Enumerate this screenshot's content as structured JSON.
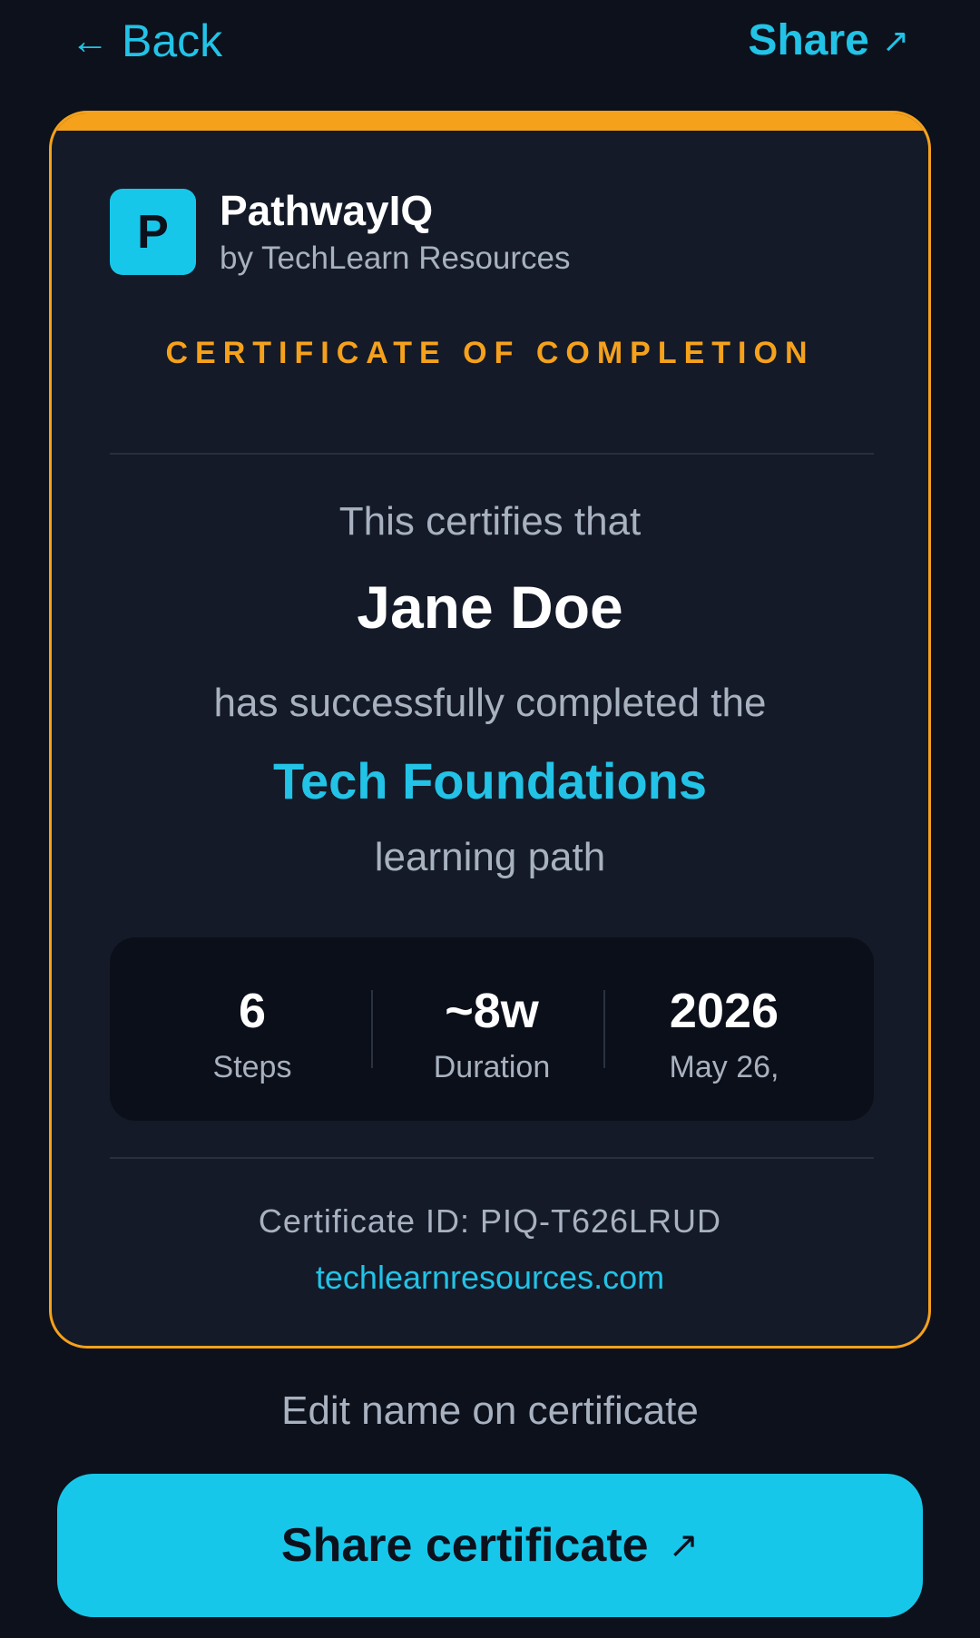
{
  "header": {
    "back_label": "Back",
    "back_icon": "←",
    "share_label": "Share",
    "share_icon": "↗"
  },
  "brand": {
    "logo_letter": "P",
    "name": "PathwayIQ",
    "subtitle": "by TechLearn Resources"
  },
  "certificate": {
    "title": "CERTIFICATE OF COMPLETION",
    "certifies_text": "This certifies that",
    "recipient_name": "Jane Doe",
    "completed_text": "has successfully completed the",
    "path_name": "Tech Foundations",
    "path_suffix": "learning path",
    "stats": [
      {
        "value": "6",
        "label": "Steps"
      },
      {
        "value": "~8w",
        "label": "Duration"
      },
      {
        "value": "2026",
        "label": "May 26,"
      }
    ],
    "certificate_id": "Certificate ID: PIQ-T626LRUD",
    "website": "techlearnresources.com"
  },
  "actions": {
    "edit_name": "Edit name on certificate",
    "share_certificate": "Share certificate",
    "share_icon": "↗"
  },
  "colors": {
    "background": "#0c111c",
    "card": "#141a28",
    "accent_orange": "#f5a11c",
    "accent_cyan": "#22c3e6"
  }
}
